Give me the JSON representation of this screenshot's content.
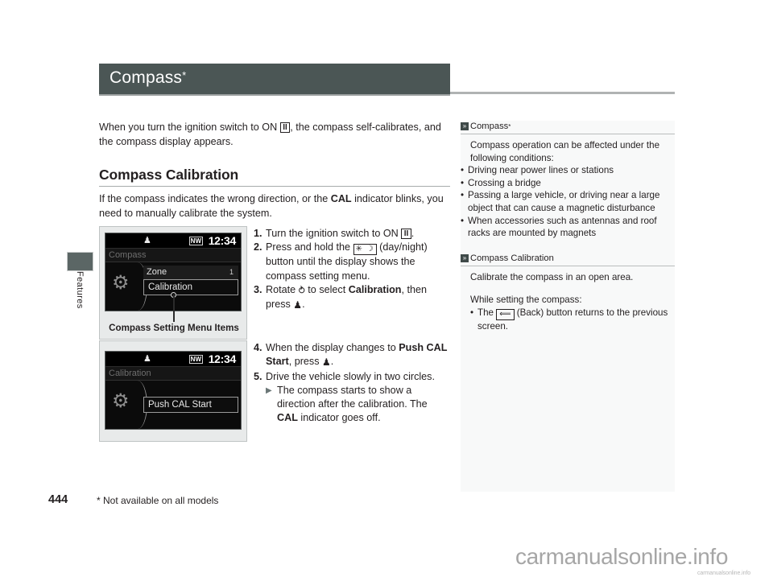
{
  "page": {
    "title": "Compass",
    "title_star": "*",
    "number": "444",
    "footnote": "* Not available on all models",
    "side_tab_label": "Features",
    "accent_dark": "#4b5655",
    "sidebar_bg": "#f8f9f9"
  },
  "watermark": {
    "main": "carmanualsonline.info",
    "sub": "carmanualsonline.info"
  },
  "main": {
    "intro_1": "When you turn the ignition switch to ON ",
    "intro_key": "II",
    "intro_2": ", the compass self-calibrates, and the compass display appears.",
    "section_heading": "Compass Calibration",
    "section_intro_1": "If the compass indicates the wrong direction, or the ",
    "section_intro_bold": "CAL",
    "section_intro_2": " indicator blinks, you need to manually calibrate the system.",
    "steps_group_1": [
      {
        "num": "1.",
        "parts": [
          {
            "t": "text",
            "v": "Turn the ignition switch to ON "
          },
          {
            "t": "key",
            "v": "II"
          },
          {
            "t": "text",
            "v": "."
          }
        ]
      },
      {
        "num": "2.",
        "parts": [
          {
            "t": "text",
            "v": "Press and hold the "
          },
          {
            "t": "daynight",
            "v": "✳ ☽"
          },
          {
            "t": "text",
            "v": " (day/night) button until the display shows the compass setting menu."
          }
        ]
      },
      {
        "num": "3.",
        "parts": [
          {
            "t": "text",
            "v": "Rotate "
          },
          {
            "t": "dial",
            "v": "⥁"
          },
          {
            "t": "text",
            "v": " to select "
          },
          {
            "t": "bold",
            "v": "Calibration"
          },
          {
            "t": "text",
            "v": ", then press "
          },
          {
            "t": "enter",
            "v": "♟"
          },
          {
            "t": "text",
            "v": "."
          }
        ]
      }
    ],
    "steps_group_2": [
      {
        "num": "4.",
        "parts": [
          {
            "t": "text",
            "v": "When the display changes to "
          },
          {
            "t": "bold",
            "v": "Push CAL Start"
          },
          {
            "t": "text",
            "v": ", press "
          },
          {
            "t": "enter",
            "v": "♟"
          },
          {
            "t": "text",
            "v": "."
          }
        ]
      },
      {
        "num": "5.",
        "parts": [
          {
            "t": "text",
            "v": "Drive the vehicle slowly in two circles."
          }
        ]
      }
    ],
    "substep": {
      "arrow": "▶",
      "parts": [
        {
          "t": "text",
          "v": "The compass starts to show a direction after the calibration. The "
        },
        {
          "t": "bold",
          "v": "CAL"
        },
        {
          "t": "text",
          "v": " indicator goes off."
        }
      ]
    }
  },
  "figures": [
    {
      "name": "compass-setting-menu-screen",
      "status": {
        "key_icon": "key-icon",
        "direction": "NW",
        "clock": "12:34"
      },
      "screen_title": "Compass",
      "gear_icon": "gear-icon",
      "rows": [
        {
          "label": "Zone",
          "value": "1",
          "selected": false
        },
        {
          "label": "Calibration",
          "value": "",
          "selected": true
        }
      ],
      "caption": "Compass Setting Menu Items"
    },
    {
      "name": "push-cal-start-screen",
      "status": {
        "key_icon": "key-icon",
        "direction": "NW",
        "clock": "12:34"
      },
      "screen_title": "Calibration",
      "gear_icon": "gear-icon",
      "rows": [
        {
          "label": "Push CAL Start",
          "value": "",
          "selected": true
        }
      ],
      "caption": ""
    }
  ],
  "sidebar": {
    "blocks": [
      {
        "marker": "»",
        "heading": "Compass",
        "heading_star": "*",
        "intro": "Compass operation can be affected under the following conditions:",
        "bullets": [
          "Driving near power lines or stations",
          "Crossing a bridge",
          "Passing a large vehicle, or driving near a large object that can cause a magnetic disturbance",
          "When accessories such as antennas and roof racks are mounted by magnets"
        ]
      },
      {
        "marker": "»",
        "heading": "Compass Calibration",
        "heading_star": "",
        "intro": "Calibrate the compass in an open area.",
        "subintro": "While setting the compass:",
        "bullet_back_pre": "The ",
        "bullet_back_icon": "back-button-icon",
        "bullet_back_post": " (Back) button returns to the previous screen."
      }
    ]
  }
}
